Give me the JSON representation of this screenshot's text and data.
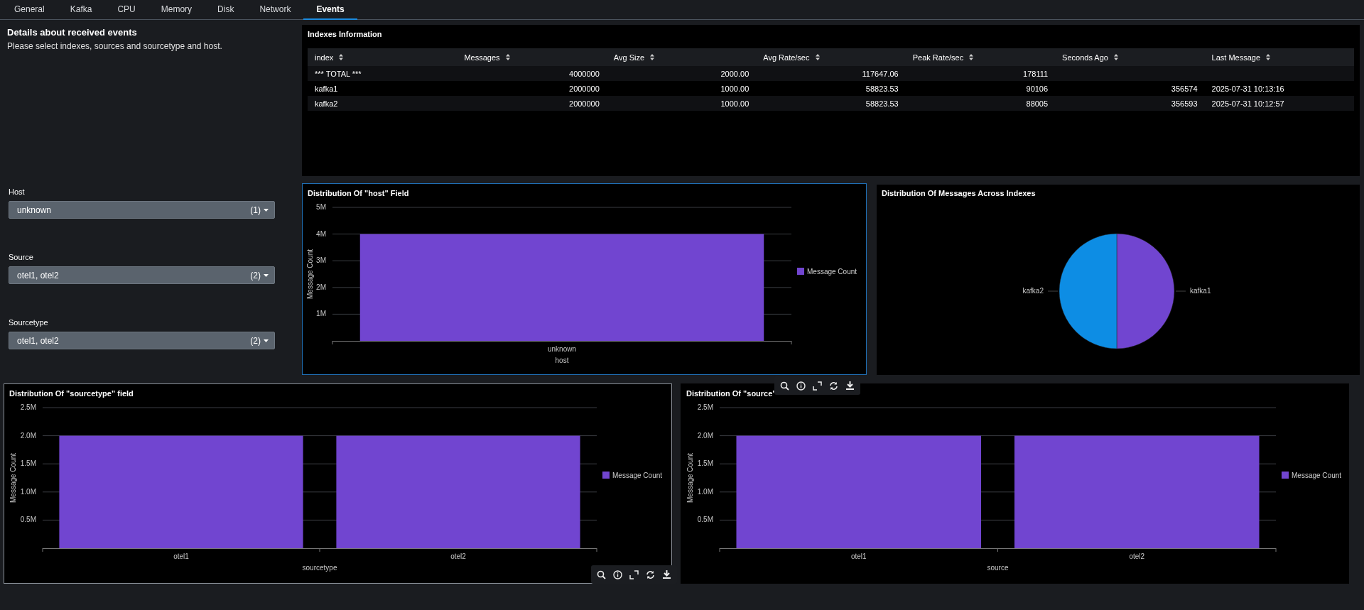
{
  "tabs": [
    {
      "label": "General",
      "selected": false
    },
    {
      "label": "Kafka",
      "selected": false
    },
    {
      "label": "CPU",
      "selected": false
    },
    {
      "label": "Memory",
      "selected": false
    },
    {
      "label": "Disk",
      "selected": false
    },
    {
      "label": "Network",
      "selected": false
    },
    {
      "label": "Events",
      "selected": true
    }
  ],
  "intro": {
    "title": "Details about received events",
    "text": "Please select indexes, sources and sourcetype and host."
  },
  "filters": [
    {
      "label": "Host",
      "value": "unknown",
      "count": "(1)"
    },
    {
      "label": "Source",
      "value": "otel1, otel2",
      "count": "(2)"
    },
    {
      "label": "Sourcetype",
      "value": "otel1, otel2",
      "count": "(2)"
    }
  ],
  "indexes_panel": {
    "title": "Indexes Information",
    "columns": [
      "index",
      "Messages",
      "Avg Size",
      "Avg Rate/sec",
      "Peak Rate/sec",
      "Seconds Ago",
      "Last Message"
    ],
    "rows": [
      [
        "*** TOTAL ***",
        "4000000",
        "2000.00",
        "117647.06",
        "178111"
      ],
      [
        "kafka1",
        "2000000",
        "1000.00",
        "58823.53",
        "90106",
        "356574",
        "2025-07-31 10:13:16"
      ],
      [
        "kafka2",
        "2000000",
        "1000.00",
        "58823.53",
        "88005",
        "356593",
        "2025-07-31 10:12:57"
      ]
    ]
  },
  "host_chart": {
    "title": "Distribution Of \"host\" Field",
    "chart_data": {
      "type": "bar",
      "grid": true,
      "xlabel": "host",
      "ylabel": "Message Count",
      "categories": [
        "unknown"
      ],
      "series": [
        {
          "name": "Message Count",
          "color": "#7145d0",
          "values": [
            4000000
          ]
        }
      ],
      "ylim": [
        0,
        5000000
      ],
      "yticks": [
        {
          "value": 1000000,
          "label": "1M"
        },
        {
          "value": 2000000,
          "label": "2M"
        },
        {
          "value": 3000000,
          "label": "3M"
        },
        {
          "value": 4000000,
          "label": "4M"
        },
        {
          "value": 5000000,
          "label": "5M"
        }
      ]
    }
  },
  "index_pie": {
    "title": "Distribution Of Messages Across Indexes",
    "chart_data": {
      "type": "pie",
      "categories": [
        "kafka1",
        "kafka2"
      ],
      "values": [
        50,
        50
      ]
    }
  },
  "sourcetype_chart": {
    "title": "Distribution Of \"sourcetype\" field",
    "chart_data": {
      "type": "bar",
      "grid": true,
      "xlabel": "sourcetype",
      "ylabel": "Message Count",
      "categories": [
        "otel1",
        "otel2"
      ],
      "series": [
        {
          "name": "Message Count",
          "color": "#7145d0",
          "values": [
            2000000,
            2000000
          ]
        }
      ],
      "ylim": [
        0,
        2500000
      ],
      "yticks": [
        {
          "value": 500000,
          "label": "0.5M"
        },
        {
          "value": 1000000,
          "label": "1.0M"
        },
        {
          "value": 1500000,
          "label": "1.5M"
        },
        {
          "value": 2000000,
          "label": "2.0M"
        },
        {
          "value": 2500000,
          "label": "2.5M"
        }
      ]
    }
  },
  "source_chart": {
    "title": "Distribution Of \"source\"",
    "chart_data": {
      "type": "bar",
      "grid": true,
      "xlabel": "source",
      "ylabel": "Message Count",
      "categories": [
        "otel1",
        "otel2"
      ],
      "series": [
        {
          "name": "Message Count",
          "color": "#7145d0",
          "values": [
            2000000,
            2000000
          ]
        }
      ],
      "ylim": [
        0,
        2500000
      ],
      "yticks": [
        {
          "value": 500000,
          "label": "0.5M"
        },
        {
          "value": 1000000,
          "label": "1.0M"
        },
        {
          "value": 1500000,
          "label": "1.5M"
        },
        {
          "value": 2000000,
          "label": "2.0M"
        },
        {
          "value": 2500000,
          "label": "2.5M"
        }
      ]
    }
  }
}
